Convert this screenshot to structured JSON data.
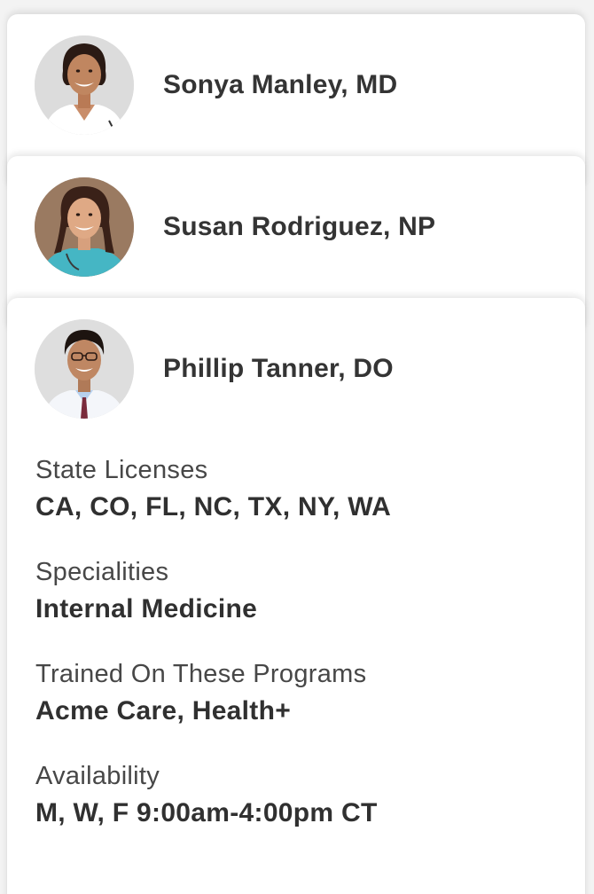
{
  "providers": [
    {
      "name": "Sonya Manley, MD",
      "avatar_icon": "doctor-avatar-sonya"
    },
    {
      "name": "Susan Rodriguez, NP",
      "avatar_icon": "nurse-avatar-susan"
    },
    {
      "name": "Phillip Tanner, DO",
      "avatar_icon": "doctor-avatar-phillip",
      "details": [
        {
          "label": "State Licenses",
          "value": "CA, CO, FL, NC, TX, NY, WA"
        },
        {
          "label": "Specialities",
          "value": "Internal Medicine"
        },
        {
          "label": "Trained On These Programs",
          "value": "Acme Care, Health+"
        },
        {
          "label": "Availability",
          "value": "M, W, F 9:00am-4:00pm CT"
        }
      ]
    }
  ]
}
